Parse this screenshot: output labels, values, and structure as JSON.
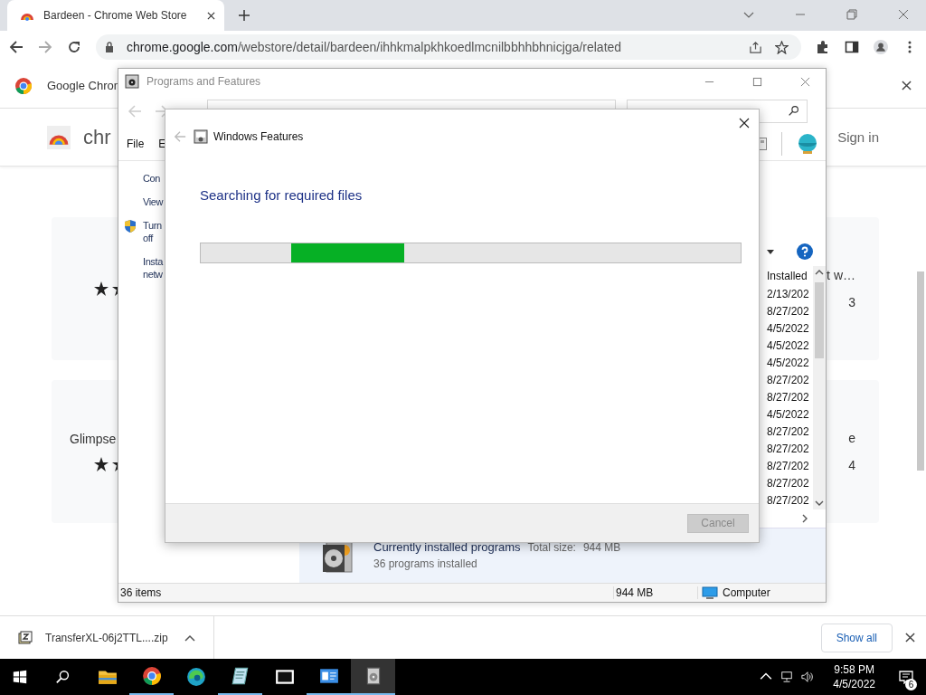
{
  "browser": {
    "tabs": [
      {
        "title": "Bardeen - Chrome Web Store",
        "selected": true
      }
    ],
    "url_host": "chrome.google.com",
    "url_path": "/webstore/detail/bardeen/ihhkmalpkhkoedlmcnilbbhhbhnicjga/related"
  },
  "infobar": {
    "text": "Google Chron"
  },
  "store_header": {
    "brand": "chr",
    "sign_in": "Sign in"
  },
  "left_cards": [
    {
      "kind": "rated"
    },
    {
      "kind": "rated",
      "title": "Glimpse"
    }
  ],
  "right_cards": [
    {
      "title": "t w…",
      "line": "3"
    },
    {
      "title": "e",
      "line": "4"
    }
  ],
  "programs_window": {
    "title": "Programs and Features",
    "menu": [
      "File",
      "E"
    ],
    "tasks": [
      {
        "lines": [
          "Con"
        ],
        "shield": false
      },
      {
        "lines": [
          "View"
        ],
        "shield": false
      },
      {
        "lines": [
          "Turn",
          "off"
        ],
        "shield": true
      },
      {
        "lines": [
          "Insta",
          "netw"
        ],
        "shield": false
      }
    ],
    "column": "Installed",
    "dates": [
      "2/13/202",
      "8/27/202",
      "4/5/2022",
      "4/5/2022",
      "4/5/2022",
      "8/27/202",
      "8/27/202",
      "4/5/2022",
      "8/27/202",
      "8/27/202",
      "8/27/202",
      "8/27/202",
      "8/27/202"
    ],
    "details": {
      "heading": "Currently installed programs",
      "size_label": "Total size:",
      "size": "944 MB",
      "count": "36 programs installed"
    },
    "status": {
      "items": "36 items",
      "size": "944 MB",
      "location": "Computer"
    }
  },
  "dialog": {
    "title": "Windows Features",
    "heading": "Searching for required files",
    "progress": {
      "level": 0.21
    },
    "cancel": {
      "label": "Cancel",
      "disabled": true
    }
  },
  "downloads": {
    "file": "TransferXL-06j2TTL....zip",
    "show_all": "Show all"
  },
  "taskbar": {
    "apps": [
      {
        "kind": "explorer",
        "running": false,
        "active": false
      },
      {
        "kind": "chrome",
        "running": true,
        "active": false
      },
      {
        "kind": "edge",
        "running": false,
        "active": false
      },
      {
        "kind": "notepad",
        "running": true,
        "active": false
      },
      {
        "kind": "archiver",
        "running": false,
        "active": false
      },
      {
        "kind": "control",
        "running": true,
        "active": false
      },
      {
        "kind": "installer",
        "running": true,
        "active": true
      }
    ],
    "time": "9:58 PM",
    "date": "4/5/2022",
    "notifications": "6"
  }
}
